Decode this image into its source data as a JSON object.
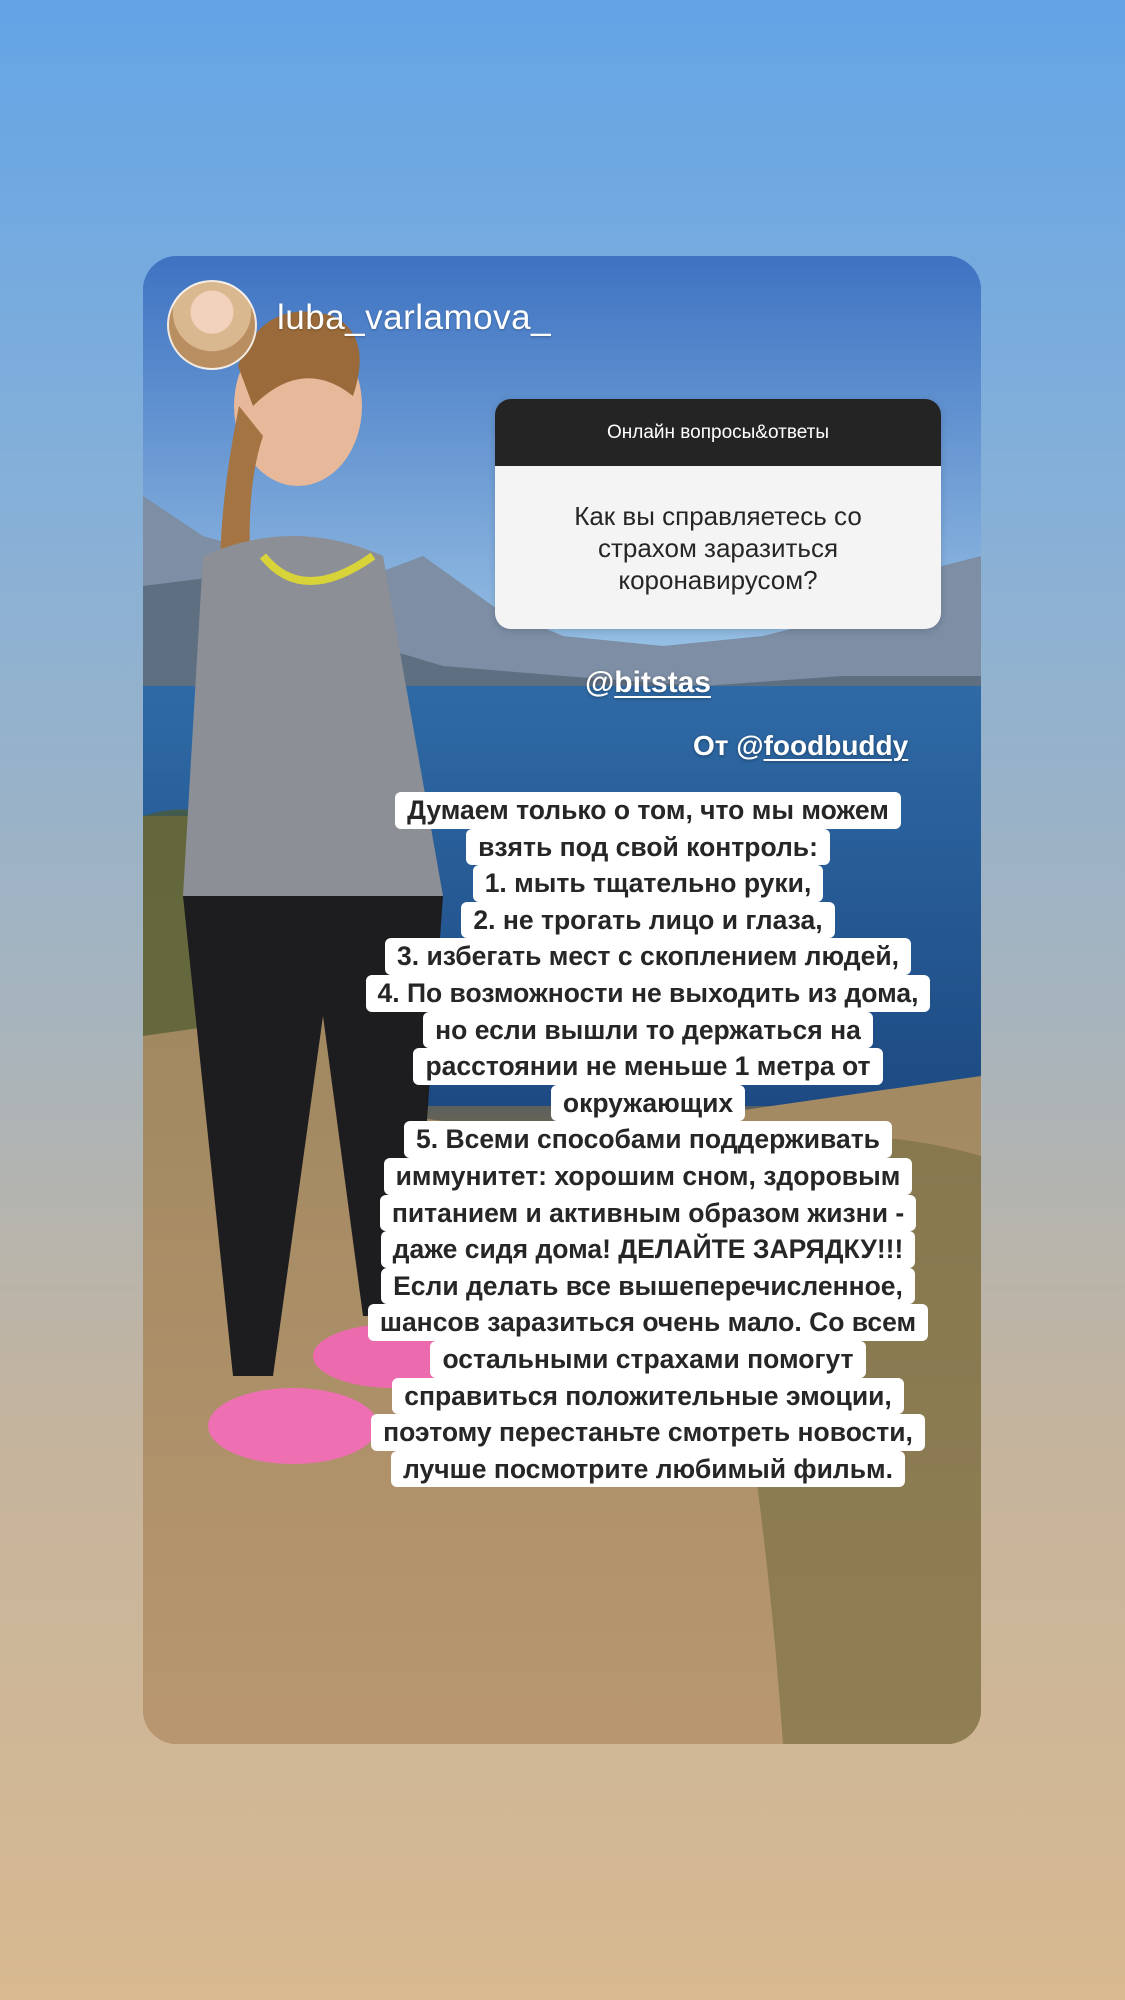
{
  "story": {
    "username": "luba_varlamova_",
    "question_card": {
      "header": "Онлайн вопросы&ответы",
      "question": "Как вы справляетесь со страхом заразиться коронавирусом?"
    },
    "mention_tag": "@",
    "mention_user": "bitstas",
    "from_prefix": "От @",
    "from_user": "foodbuddy",
    "answer_lines": [
      "Думаем только о том, что мы можем",
      "взять под свой контроль:",
      "1. мыть тщательно руки,",
      "2. не трогать лицо и глаза,",
      "3. избегать мест с скоплением людей,",
      "4. По возможности не выходить из дома,",
      "но если вышли то держаться  на",
      "расстоянии не меньше 1 метра от",
      "окружающих",
      "5. Всеми способами поддерживать",
      "иммунитет: хорошим сном, здоровым",
      "питанием и активным образом жизни -",
      "даже сидя дома! ДЕЛАЙТЕ  ЗАРЯДКУ!!!",
      "Если делать все вышеперечисленное,",
      "шансов заразиться очень мало. Со всем",
      "остальными страхами помогут",
      "справиться положительные эмоции,",
      "поэтому перестаньте смотреть новости,",
      "лучше посмотрите любимый фильм."
    ]
  }
}
